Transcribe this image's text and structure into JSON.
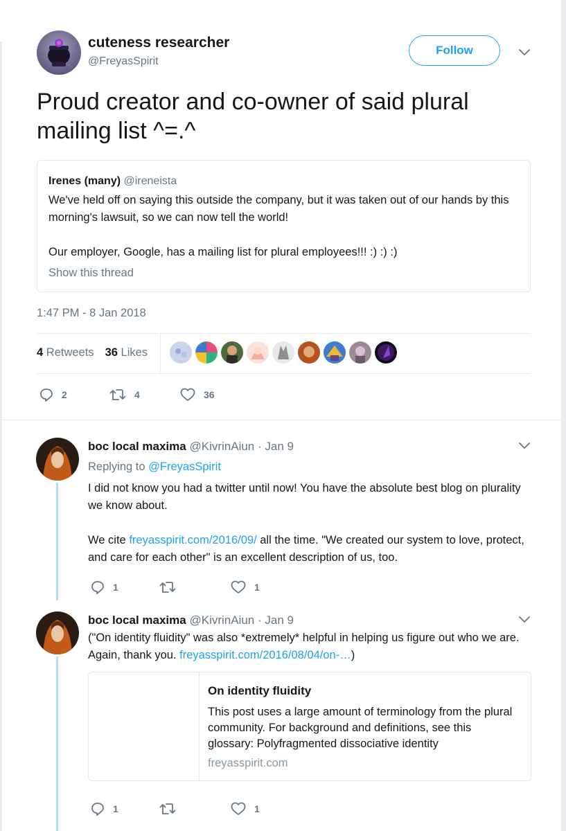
{
  "main_tweet": {
    "author_name": "cuteness researcher",
    "author_handle": "@FreyasSpirit",
    "follow_label": "Follow",
    "text": "Proud creator and co-owner of said plural mailing list ^=.^",
    "timestamp": "1:47 PM - 8 Jan 2018",
    "retweets_count": "4",
    "retweets_label": "Retweets",
    "likes_count": "36",
    "likes_label": "Likes",
    "actions": {
      "replies": "2",
      "retweets": "4",
      "likes": "36"
    },
    "liker_avatar_colors": [
      "#c9d3ea",
      "#e94f7a",
      "#4a6b3a",
      "#f3b0a2",
      "#8f8f8f",
      "#b5521d",
      "#3f7ccf",
      "#9c8a95",
      "#3a1c5e"
    ]
  },
  "quoted_tweet": {
    "author_name": "Irenes (many)",
    "author_handle": "@ireneista",
    "paragraph_1": "We've held off on saying this outside the company, but it was taken out of our hands by this morning's lawsuit, so we can now tell the world!",
    "paragraph_2": "Our employer, Google, has a mailing list for plural employees!!! :) :) :)",
    "show_thread": "Show this thread"
  },
  "replies": [
    {
      "author_name": "boc local maxima",
      "author_handle": "@KivrinAiun",
      "time": "· Jan 9",
      "replying_to_label": "Replying to",
      "replying_to_handle": "@FreyasSpirit",
      "paragraph_1": "I did not know you had a twitter until now! You have the absolute best blog on plurality we know about.",
      "p2_before": "We cite",
      "p2_link": "freyasspirit.com/2016/09/",
      "p2_after": "all the time. \"We created our system to love, protect, and care for each other\" is an excellent description of us, too.",
      "actions": {
        "replies": "1",
        "retweets": "",
        "likes": "1"
      }
    },
    {
      "author_name": "boc local maxima",
      "author_handle": "@KivrinAiun",
      "time": "· Jan 9",
      "text_before": "(\"On identity fluidity\" was also *extremely* helpful in helping us figure out who we are. Again, thank you.",
      "link": "freyasspirit.com/2016/08/04/on-…",
      "text_after": ")",
      "card": {
        "title": "On identity fluidity",
        "description": "This post uses a large amount of terminology from the plural community.  For background and definitions, see this glossary: Polyfragmented dissociative identity",
        "domain": "freyasspirit.com"
      },
      "actions": {
        "replies": "1",
        "retweets": "",
        "likes": "1"
      }
    }
  ],
  "colors": {
    "accent": "#1da1f2",
    "secondary_text": "#657786",
    "primary_text": "#14171a",
    "thread_line": "#b6dcf7",
    "border": "#e1e8ed"
  }
}
